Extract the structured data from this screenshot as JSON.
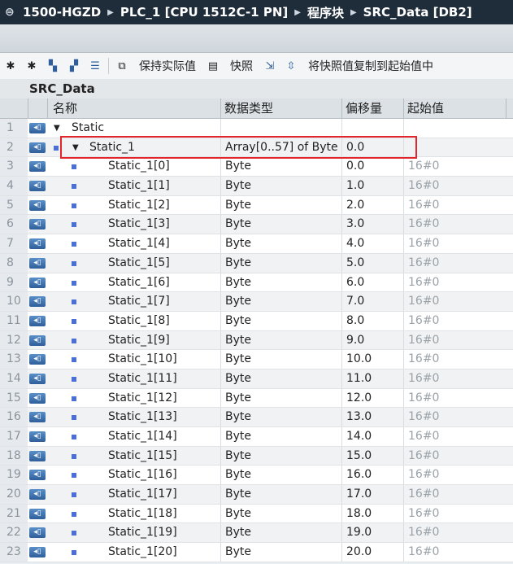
{
  "breadcrumb": {
    "project": "1500-HGZD",
    "plc": "PLC_1 [CPU 1512C-1 PN]",
    "folder": "程序块",
    "block": "SRC_Data [DB2]"
  },
  "toolbar": {
    "keep_actual_label": "保持实际值",
    "snapshot_label": "快照",
    "copy_snapshot_label": "将快照值复制到起始值中"
  },
  "block_name": "SRC_Data",
  "columns": {
    "name": "名称",
    "data_type": "数据类型",
    "offset": "偏移量",
    "start_value": "起始值"
  },
  "rows": [
    {
      "num": "1",
      "name": "Static",
      "type": "",
      "offset": "",
      "start": ""
    },
    {
      "num": "2",
      "name": "Static_1",
      "type": "Array[0..57] of Byte",
      "offset": "0.0",
      "start": ""
    },
    {
      "num": "3",
      "name": "Static_1[0]",
      "type": "Byte",
      "offset": "0.0",
      "start": "16#0"
    },
    {
      "num": "4",
      "name": "Static_1[1]",
      "type": "Byte",
      "offset": "1.0",
      "start": "16#0"
    },
    {
      "num": "5",
      "name": "Static_1[2]",
      "type": "Byte",
      "offset": "2.0",
      "start": "16#0"
    },
    {
      "num": "6",
      "name": "Static_1[3]",
      "type": "Byte",
      "offset": "3.0",
      "start": "16#0"
    },
    {
      "num": "7",
      "name": "Static_1[4]",
      "type": "Byte",
      "offset": "4.0",
      "start": "16#0"
    },
    {
      "num": "8",
      "name": "Static_1[5]",
      "type": "Byte",
      "offset": "5.0",
      "start": "16#0"
    },
    {
      "num": "9",
      "name": "Static_1[6]",
      "type": "Byte",
      "offset": "6.0",
      "start": "16#0"
    },
    {
      "num": "10",
      "name": "Static_1[7]",
      "type": "Byte",
      "offset": "7.0",
      "start": "16#0"
    },
    {
      "num": "11",
      "name": "Static_1[8]",
      "type": "Byte",
      "offset": "8.0",
      "start": "16#0"
    },
    {
      "num": "12",
      "name": "Static_1[9]",
      "type": "Byte",
      "offset": "9.0",
      "start": "16#0"
    },
    {
      "num": "13",
      "name": "Static_1[10]",
      "type": "Byte",
      "offset": "10.0",
      "start": "16#0"
    },
    {
      "num": "14",
      "name": "Static_1[11]",
      "type": "Byte",
      "offset": "11.0",
      "start": "16#0"
    },
    {
      "num": "15",
      "name": "Static_1[12]",
      "type": "Byte",
      "offset": "12.0",
      "start": "16#0"
    },
    {
      "num": "16",
      "name": "Static_1[13]",
      "type": "Byte",
      "offset": "13.0",
      "start": "16#0"
    },
    {
      "num": "17",
      "name": "Static_1[14]",
      "type": "Byte",
      "offset": "14.0",
      "start": "16#0"
    },
    {
      "num": "18",
      "name": "Static_1[15]",
      "type": "Byte",
      "offset": "15.0",
      "start": "16#0"
    },
    {
      "num": "19",
      "name": "Static_1[16]",
      "type": "Byte",
      "offset": "16.0",
      "start": "16#0"
    },
    {
      "num": "20",
      "name": "Static_1[17]",
      "type": "Byte",
      "offset": "17.0",
      "start": "16#0"
    },
    {
      "num": "21",
      "name": "Static_1[18]",
      "type": "Byte",
      "offset": "18.0",
      "start": "16#0"
    },
    {
      "num": "22",
      "name": "Static_1[19]",
      "type": "Byte",
      "offset": "19.0",
      "start": "16#0"
    },
    {
      "num": "23",
      "name": "Static_1[20]",
      "type": "Byte",
      "offset": "20.0",
      "start": "16#0"
    }
  ],
  "colors": {
    "highlight": "#e3242b",
    "titlebar": "#1f2c3a",
    "element_marker": "#4c6fd6"
  }
}
